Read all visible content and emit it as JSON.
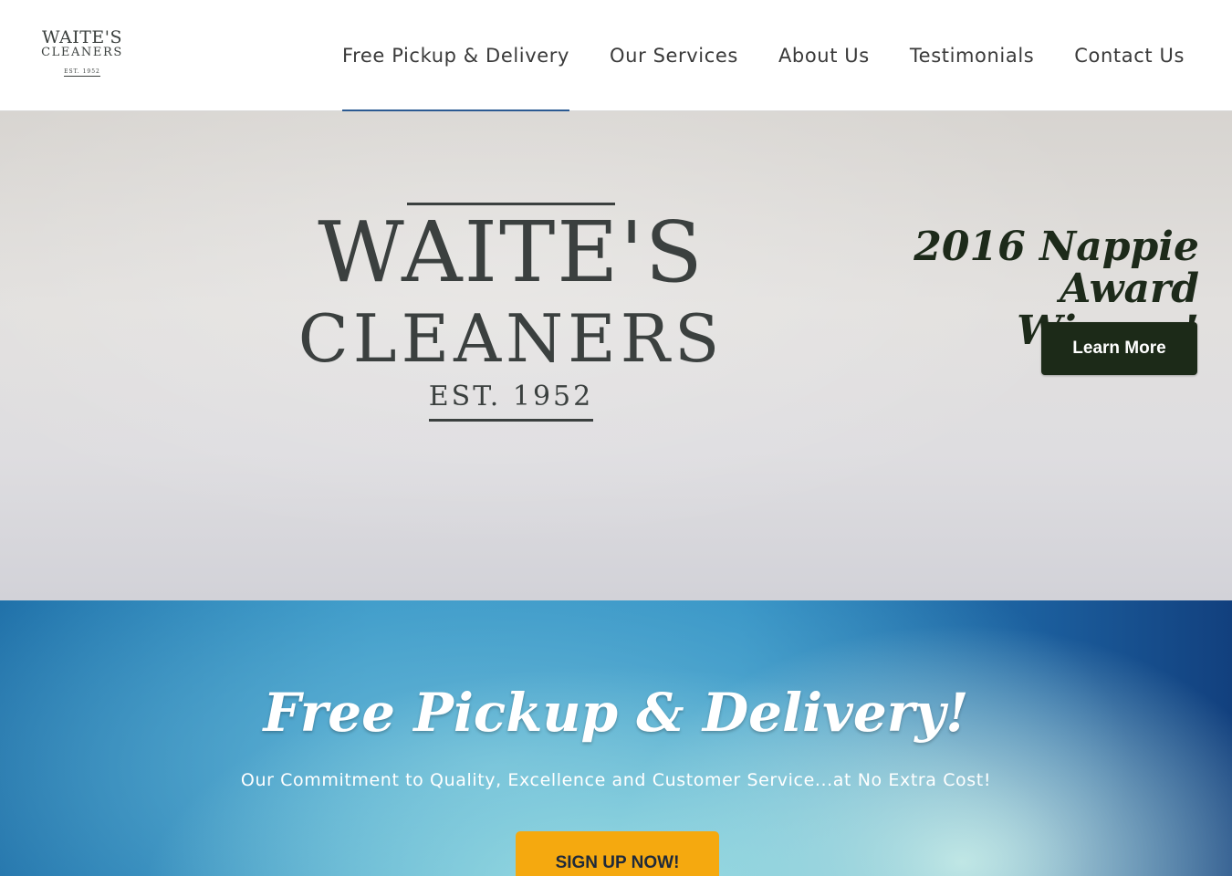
{
  "brand": {
    "logo_line1": "WAITE'S",
    "logo_line2": "CLEANERS",
    "logo_line3": "EST. 1952"
  },
  "nav": {
    "items": [
      {
        "label": "Free Pickup & Delivery",
        "active": true
      },
      {
        "label": "Our Services"
      },
      {
        "label": "About Us"
      },
      {
        "label": "Testimonials"
      },
      {
        "label": "Contact Us"
      }
    ]
  },
  "hero": {
    "sign_line1": "WAITE'S",
    "sign_line2": "CLEANERS",
    "sign_line3": "EST. 1952",
    "award_line1": "2016 Nappie Award",
    "award_line2": "Winner!",
    "learn_more_label": "Learn More"
  },
  "pickup": {
    "title": "Free Pickup & Delivery!",
    "subtitle": "Our Commitment to Quality, Excellence and Customer Service...at No Extra Cost!",
    "cta_label": "SIGN UP NOW!"
  },
  "colors": {
    "nav_active_underline": "#2b5a92",
    "learn_more_bg": "#1c2a18",
    "cta_bg": "#f5a90f",
    "section_blue": "#2a8bc2"
  }
}
